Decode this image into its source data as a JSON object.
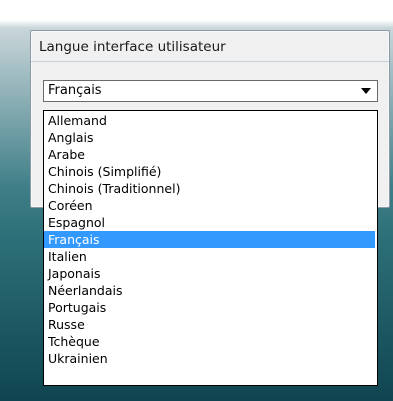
{
  "panel": {
    "title": "Langue interface utilisateur"
  },
  "select": {
    "value": "Français",
    "arrow_icon": "chevron-down-icon"
  },
  "options": [
    "Allemand",
    "Anglais",
    "Arabe",
    "Chinois (Simplifié)",
    "Chinois (Traditionnel)",
    "Coréen",
    "Espagnol",
    "Français",
    "Italien",
    "Japonais",
    "Néerlandais",
    "Portugais",
    "Russe",
    "Tchèque",
    "Ukrainien"
  ],
  "selected_option": "Français",
  "colors": {
    "selection": "#3399ff",
    "background": "#2d6f78"
  }
}
